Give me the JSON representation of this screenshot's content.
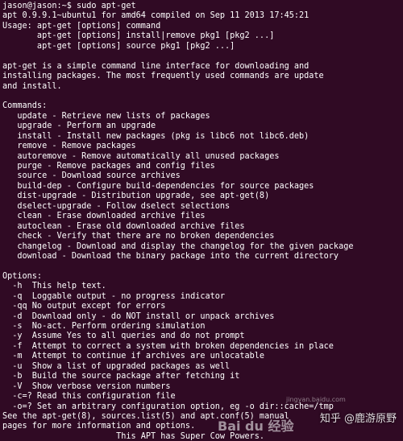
{
  "terminal": {
    "lines": [
      "jason@jason:~$ sudo apt-get",
      "apt 0.9.9.1~ubuntu1 for amd64 compiled on Sep 11 2013 17:45:21",
      "Usage: apt-get [options] command",
      "       apt-get [options] install|remove pkg1 [pkg2 ...]",
      "       apt-get [options] source pkg1 [pkg2 ...]",
      "",
      "apt-get is a simple command line interface for downloading and",
      "installing packages. The most frequently used commands are update",
      "and install.",
      "",
      "Commands:",
      "   update - Retrieve new lists of packages",
      "   upgrade - Perform an upgrade",
      "   install - Install new packages (pkg is libc6 not libc6.deb)",
      "   remove - Remove packages",
      "   autoremove - Remove automatically all unused packages",
      "   purge - Remove packages and config files",
      "   source - Download source archives",
      "   build-dep - Configure build-dependencies for source packages",
      "   dist-upgrade - Distribution upgrade, see apt-get(8)",
      "   dselect-upgrade - Follow dselect selections",
      "   clean - Erase downloaded archive files",
      "   autoclean - Erase old downloaded archive files",
      "   check - Verify that there are no broken dependencies",
      "   changelog - Download and display the changelog for the given package",
      "   download - Download the binary package into the current directory",
      "",
      "Options:",
      "  -h  This help text.",
      "  -q  Loggable output - no progress indicator",
      "  -qq No output except for errors",
      "  -d  Download only - do NOT install or unpack archives",
      "  -s  No-act. Perform ordering simulation",
      "  -y  Assume Yes to all queries and do not prompt",
      "  -f  Attempt to correct a system with broken dependencies in place",
      "  -m  Attempt to continue if archives are unlocatable",
      "  -u  Show a list of upgraded packages as well",
      "  -b  Build the source package after fetching it",
      "  -V  Show verbose version numbers",
      "  -c=? Read this configuration file",
      "  -o=? Set an arbitrary configuration option, eg -o dir::cache=/tmp",
      "See the apt-get(8), sources.list(5) and apt.conf(5) manual",
      "pages for more information and options.",
      "                       This APT has Super Cow Powers."
    ]
  },
  "watermark": {
    "text": "知乎 @鹿游原野",
    "site": "Bai du 经验",
    "url": "jingyan.baidu.com"
  }
}
